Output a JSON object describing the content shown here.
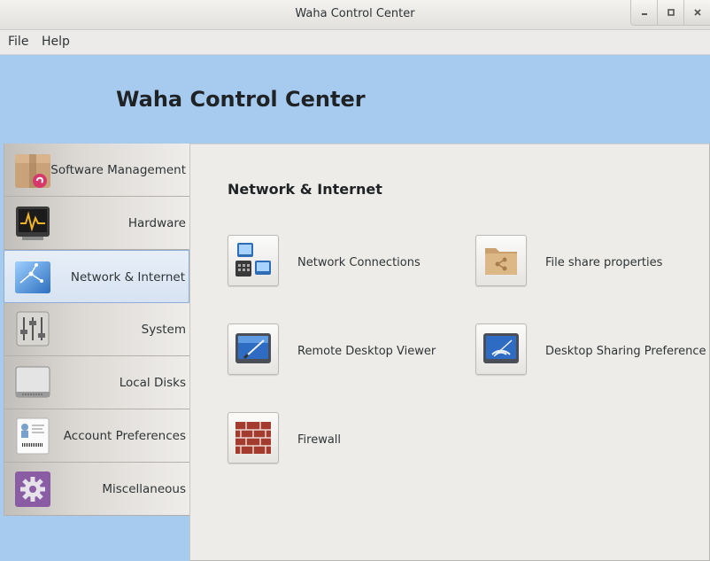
{
  "window": {
    "title": "Waha Control Center",
    "controls": [
      "minimize",
      "maximize",
      "close"
    ]
  },
  "menubar": {
    "items": [
      "File",
      "Help"
    ]
  },
  "header": {
    "title": "Waha Control Center"
  },
  "sidebar": {
    "items": [
      {
        "label": "Software Management",
        "icon": "package-icon"
      },
      {
        "label": "Hardware",
        "icon": "monitor-icon"
      },
      {
        "label": "Network & Internet",
        "icon": "network-globe-icon",
        "selected": true
      },
      {
        "label": "System",
        "icon": "sliders-icon"
      },
      {
        "label": "Local Disks",
        "icon": "disk-drive-icon"
      },
      {
        "label": "Account Preferences",
        "icon": "id-card-icon"
      },
      {
        "label": "Miscellaneous",
        "icon": "gear-icon"
      }
    ]
  },
  "main": {
    "section_title": "Network & Internet",
    "items": [
      {
        "label": "Network Connections",
        "icon": "network-connections-icon"
      },
      {
        "label": "File share properties",
        "icon": "shared-folder-icon"
      },
      {
        "label": "Remote Desktop Viewer",
        "icon": "remote-desktop-icon"
      },
      {
        "label": "Desktop Sharing Preference",
        "icon": "desktop-sharing-icon"
      },
      {
        "label": "Firewall",
        "icon": "firewall-icon"
      }
    ]
  },
  "colors": {
    "header_bg": "#a7caef",
    "content_bg": "#eeece9",
    "selection_border": "#8eadd4"
  }
}
